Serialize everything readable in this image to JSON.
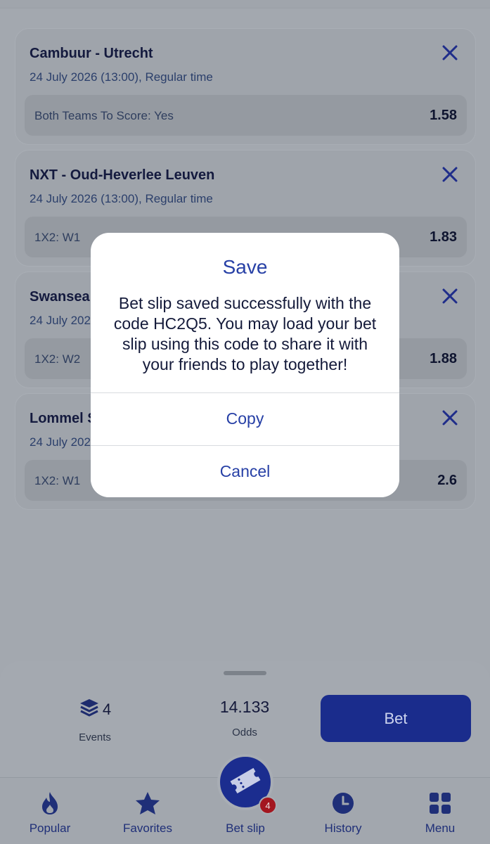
{
  "bets": [
    {
      "title": "Cambuur - Utrecht",
      "date": "24 July 2026 (13:00), Regular time",
      "market": "Both Teams To Score: Yes",
      "odds": "1.58"
    },
    {
      "title": "NXT - Oud-Heverlee Leuven",
      "date": "24 July 2026 (13:00), Regular time",
      "market": "1X2: W1",
      "odds": "1.83"
    },
    {
      "title": "Swansea",
      "date": "24 July 202",
      "market": "1X2: W2",
      "odds": "1.88"
    },
    {
      "title": "Lommel S",
      "date": "24 July 202",
      "market": "1X2: W1",
      "odds": "2.6"
    }
  ],
  "summary": {
    "events_count": "4",
    "events_label": "Events",
    "odds_value": "14.133",
    "odds_label": "Odds",
    "bet_button": "Bet"
  },
  "nav": {
    "items": [
      {
        "label": "Popular",
        "icon": "flame-icon"
      },
      {
        "label": "Favorites",
        "icon": "star-icon"
      },
      {
        "label": "Bet slip",
        "icon": "ticket-icon"
      },
      {
        "label": "History",
        "icon": "clock-icon"
      },
      {
        "label": "Menu",
        "icon": "grid-icon"
      }
    ],
    "betslip_badge": "4"
  },
  "modal": {
    "title": "Save",
    "body": "Bet slip saved successfully with the code HC2Q5. You may load your bet slip using this code to share it with your friends to play together!",
    "copy_button": "Copy",
    "cancel_button": "Cancel"
  },
  "colors": {
    "accent": "#2740a6",
    "primary_button": "#1a2c8c",
    "badge": "#a3161f",
    "overlay": "#a3a8af"
  }
}
